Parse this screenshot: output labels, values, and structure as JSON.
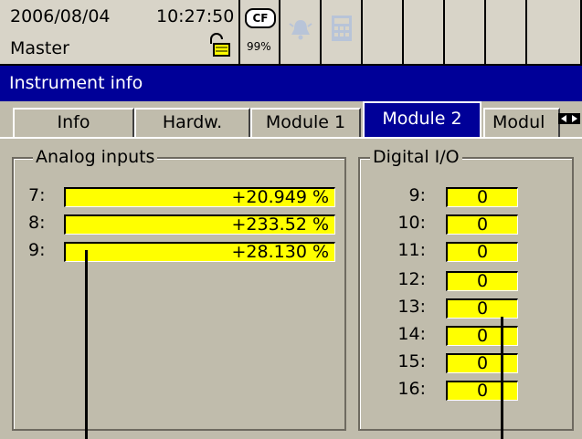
{
  "status": {
    "date": "2006/08/04",
    "time": "10:27:50",
    "mode": "Master",
    "cf_label": "CF",
    "cf_usage": "99%"
  },
  "title": "Instrument info",
  "tabs": [
    {
      "label": "Info",
      "active": false
    },
    {
      "label": "Hardw.",
      "active": false
    },
    {
      "label": "Module 1",
      "active": false
    },
    {
      "label": "Module 2",
      "active": true
    },
    {
      "label": "Modul",
      "active": false
    }
  ],
  "analog": {
    "title": "Analog inputs",
    "rows": [
      {
        "label": "7:",
        "value": "+20.949 %"
      },
      {
        "label": "8:",
        "value": "+233.52 %"
      },
      {
        "label": "9:",
        "value": "+28.130 %"
      }
    ]
  },
  "digital": {
    "title": "Digital I/O",
    "rows": [
      {
        "label": "9:",
        "value": "0"
      },
      {
        "label": "10:",
        "value": "0"
      },
      {
        "label": "11:",
        "value": "0"
      },
      {
        "label": "12:",
        "value": "0"
      },
      {
        "label": "13:",
        "value": "0"
      },
      {
        "label": "14:",
        "value": "0"
      },
      {
        "label": "15:",
        "value": "0"
      },
      {
        "label": "16:",
        "value": "0"
      }
    ]
  },
  "colors": {
    "background": "#c0bcac",
    "titlebar": "#000098",
    "field": "#ffff00"
  },
  "icons": [
    "lock-icon",
    "cf-card-icon",
    "alarm-bell-icon",
    "calculator-icon",
    "scroll-left-icon",
    "scroll-right-icon"
  ]
}
